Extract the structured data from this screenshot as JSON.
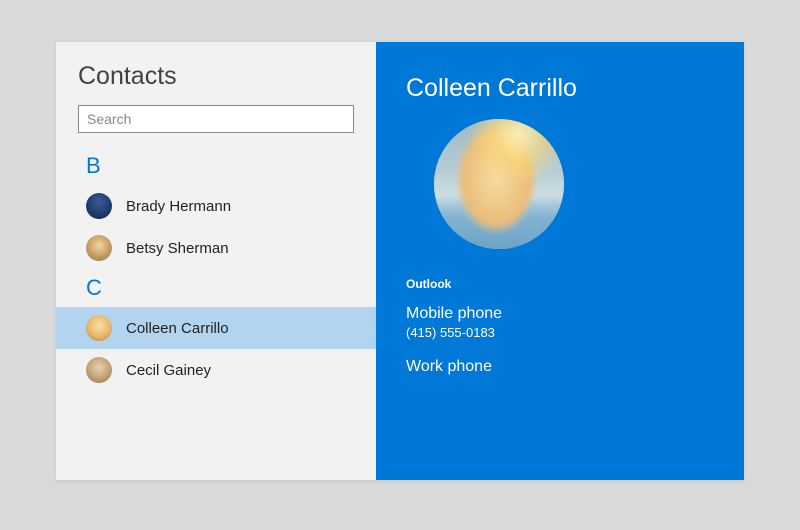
{
  "sidebar": {
    "title": "Contacts",
    "search_placeholder": "Search",
    "groups": [
      {
        "letter": "B",
        "items": [
          {
            "name": "Brady Hermann",
            "avatar_class": "av-b1",
            "selected": false
          },
          {
            "name": "Betsy Sherman",
            "avatar_class": "av-b2",
            "selected": false
          }
        ]
      },
      {
        "letter": "C",
        "items": [
          {
            "name": "Colleen Carrillo",
            "avatar_class": "av-c1",
            "selected": true
          },
          {
            "name": "Cecil Gainey",
            "avatar_class": "av-c2",
            "selected": false
          }
        ]
      }
    ]
  },
  "detail": {
    "name": "Colleen Carrillo",
    "source_label": "Outlook",
    "fields": [
      {
        "label": "Mobile phone",
        "value": "(415) 555-0183"
      },
      {
        "label": "Work phone",
        "value": ""
      }
    ]
  },
  "colors": {
    "accent": "#0078d7",
    "selected_row": "#b3d4ef"
  }
}
